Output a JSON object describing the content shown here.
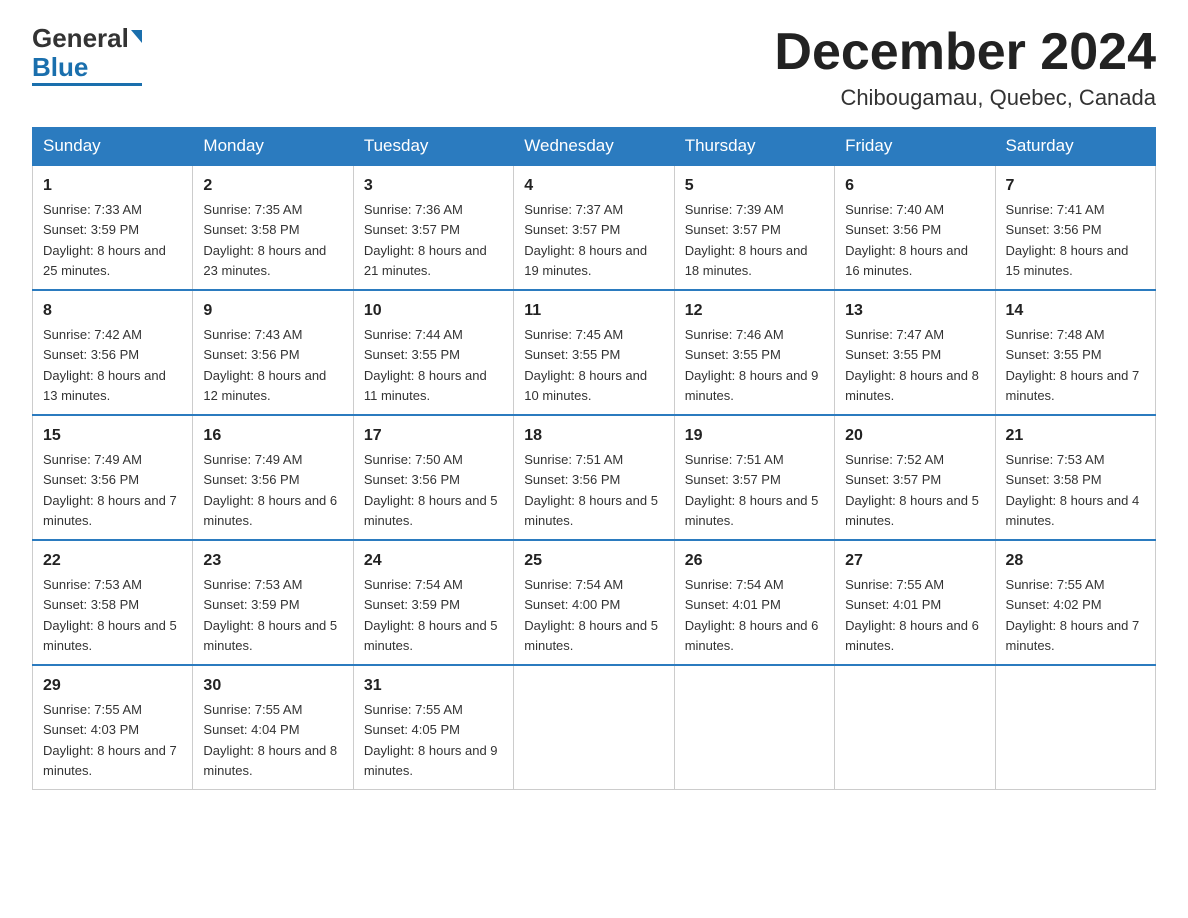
{
  "header": {
    "logo_general": "General",
    "logo_blue": "Blue",
    "month_title": "December 2024",
    "location": "Chibougamau, Quebec, Canada"
  },
  "weekdays": [
    "Sunday",
    "Monday",
    "Tuesday",
    "Wednesday",
    "Thursday",
    "Friday",
    "Saturday"
  ],
  "weeks": [
    [
      {
        "day": "1",
        "sunrise": "7:33 AM",
        "sunset": "3:59 PM",
        "daylight": "8 hours and 25 minutes."
      },
      {
        "day": "2",
        "sunrise": "7:35 AM",
        "sunset": "3:58 PM",
        "daylight": "8 hours and 23 minutes."
      },
      {
        "day": "3",
        "sunrise": "7:36 AM",
        "sunset": "3:57 PM",
        "daylight": "8 hours and 21 minutes."
      },
      {
        "day": "4",
        "sunrise": "7:37 AM",
        "sunset": "3:57 PM",
        "daylight": "8 hours and 19 minutes."
      },
      {
        "day": "5",
        "sunrise": "7:39 AM",
        "sunset": "3:57 PM",
        "daylight": "8 hours and 18 minutes."
      },
      {
        "day": "6",
        "sunrise": "7:40 AM",
        "sunset": "3:56 PM",
        "daylight": "8 hours and 16 minutes."
      },
      {
        "day": "7",
        "sunrise": "7:41 AM",
        "sunset": "3:56 PM",
        "daylight": "8 hours and 15 minutes."
      }
    ],
    [
      {
        "day": "8",
        "sunrise": "7:42 AM",
        "sunset": "3:56 PM",
        "daylight": "8 hours and 13 minutes."
      },
      {
        "day": "9",
        "sunrise": "7:43 AM",
        "sunset": "3:56 PM",
        "daylight": "8 hours and 12 minutes."
      },
      {
        "day": "10",
        "sunrise": "7:44 AM",
        "sunset": "3:55 PM",
        "daylight": "8 hours and 11 minutes."
      },
      {
        "day": "11",
        "sunrise": "7:45 AM",
        "sunset": "3:55 PM",
        "daylight": "8 hours and 10 minutes."
      },
      {
        "day": "12",
        "sunrise": "7:46 AM",
        "sunset": "3:55 PM",
        "daylight": "8 hours and 9 minutes."
      },
      {
        "day": "13",
        "sunrise": "7:47 AM",
        "sunset": "3:55 PM",
        "daylight": "8 hours and 8 minutes."
      },
      {
        "day": "14",
        "sunrise": "7:48 AM",
        "sunset": "3:55 PM",
        "daylight": "8 hours and 7 minutes."
      }
    ],
    [
      {
        "day": "15",
        "sunrise": "7:49 AM",
        "sunset": "3:56 PM",
        "daylight": "8 hours and 7 minutes."
      },
      {
        "day": "16",
        "sunrise": "7:49 AM",
        "sunset": "3:56 PM",
        "daylight": "8 hours and 6 minutes."
      },
      {
        "day": "17",
        "sunrise": "7:50 AM",
        "sunset": "3:56 PM",
        "daylight": "8 hours and 5 minutes."
      },
      {
        "day": "18",
        "sunrise": "7:51 AM",
        "sunset": "3:56 PM",
        "daylight": "8 hours and 5 minutes."
      },
      {
        "day": "19",
        "sunrise": "7:51 AM",
        "sunset": "3:57 PM",
        "daylight": "8 hours and 5 minutes."
      },
      {
        "day": "20",
        "sunrise": "7:52 AM",
        "sunset": "3:57 PM",
        "daylight": "8 hours and 5 minutes."
      },
      {
        "day": "21",
        "sunrise": "7:53 AM",
        "sunset": "3:58 PM",
        "daylight": "8 hours and 4 minutes."
      }
    ],
    [
      {
        "day": "22",
        "sunrise": "7:53 AM",
        "sunset": "3:58 PM",
        "daylight": "8 hours and 5 minutes."
      },
      {
        "day": "23",
        "sunrise": "7:53 AM",
        "sunset": "3:59 PM",
        "daylight": "8 hours and 5 minutes."
      },
      {
        "day": "24",
        "sunrise": "7:54 AM",
        "sunset": "3:59 PM",
        "daylight": "8 hours and 5 minutes."
      },
      {
        "day": "25",
        "sunrise": "7:54 AM",
        "sunset": "4:00 PM",
        "daylight": "8 hours and 5 minutes."
      },
      {
        "day": "26",
        "sunrise": "7:54 AM",
        "sunset": "4:01 PM",
        "daylight": "8 hours and 6 minutes."
      },
      {
        "day": "27",
        "sunrise": "7:55 AM",
        "sunset": "4:01 PM",
        "daylight": "8 hours and 6 minutes."
      },
      {
        "day": "28",
        "sunrise": "7:55 AM",
        "sunset": "4:02 PM",
        "daylight": "8 hours and 7 minutes."
      }
    ],
    [
      {
        "day": "29",
        "sunrise": "7:55 AM",
        "sunset": "4:03 PM",
        "daylight": "8 hours and 7 minutes."
      },
      {
        "day": "30",
        "sunrise": "7:55 AM",
        "sunset": "4:04 PM",
        "daylight": "8 hours and 8 minutes."
      },
      {
        "day": "31",
        "sunrise": "7:55 AM",
        "sunset": "4:05 PM",
        "daylight": "8 hours and 9 minutes."
      },
      null,
      null,
      null,
      null
    ]
  ]
}
